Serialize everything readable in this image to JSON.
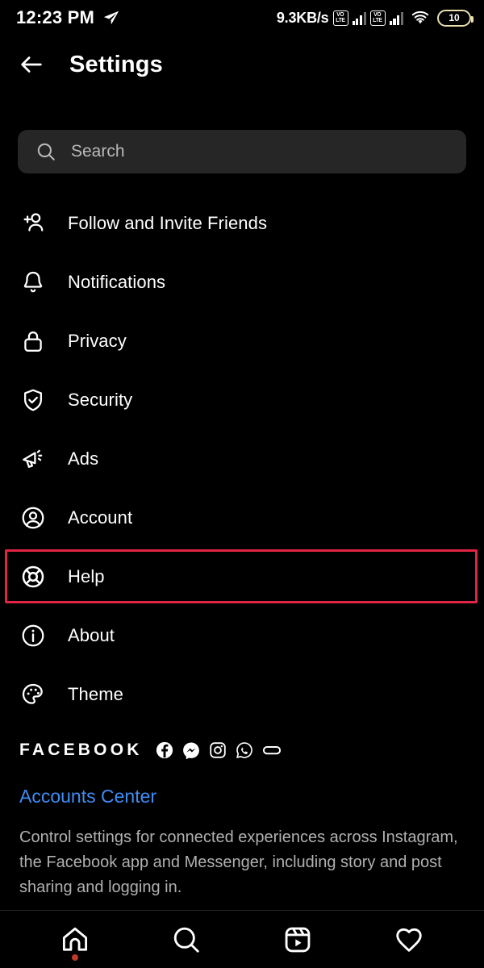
{
  "statusbar": {
    "time": "12:23 PM",
    "location_icon": "send-icon",
    "network_speed": "9.3KB/s",
    "sim1_label_top": "VO",
    "sim1_label_bottom": "LTE",
    "sim2_label_top": "VO",
    "sim2_label_bottom": "LTE",
    "wifi_icon": "wifi-icon",
    "battery_level": "10"
  },
  "topbar": {
    "back_icon": "arrow-left-icon",
    "title": "Settings"
  },
  "search": {
    "icon": "search-icon",
    "placeholder": "Search",
    "value": ""
  },
  "menu": {
    "items": [
      {
        "icon": "person-add-icon",
        "label": "Follow and Invite Friends",
        "highlighted": false
      },
      {
        "icon": "bell-icon",
        "label": "Notifications",
        "highlighted": false
      },
      {
        "icon": "lock-icon",
        "label": "Privacy",
        "highlighted": false
      },
      {
        "icon": "shield-check-icon",
        "label": "Security",
        "highlighted": false
      },
      {
        "icon": "megaphone-icon",
        "label": "Ads",
        "highlighted": false
      },
      {
        "icon": "account-circle-icon",
        "label": "Account",
        "highlighted": false
      },
      {
        "icon": "lifebuoy-icon",
        "label": "Help",
        "highlighted": true
      },
      {
        "icon": "info-circle-icon",
        "label": "About",
        "highlighted": false
      },
      {
        "icon": "palette-icon",
        "label": "Theme",
        "highlighted": false
      }
    ]
  },
  "facebook_section": {
    "brand": "FACEBOOK",
    "brand_icons": [
      "facebook-icon",
      "messenger-icon",
      "instagram-icon",
      "whatsapp-icon",
      "portal-icon"
    ],
    "link_label": "Accounts Center",
    "description": "Control settings for connected experiences across Instagram, the Facebook app and Messenger, including story and post sharing and logging in."
  },
  "bottomnav": {
    "items": [
      {
        "icon": "home-icon",
        "has_dot": true
      },
      {
        "icon": "search-icon",
        "has_dot": false
      },
      {
        "icon": "reels-icon",
        "has_dot": false
      },
      {
        "icon": "heart-icon",
        "has_dot": false
      }
    ]
  },
  "colors": {
    "background": "#000000",
    "search_field": "#262626",
    "highlight_red": "#e02444",
    "link_blue": "#3f8cf3",
    "muted_text": "#b0b0b0",
    "nav_dot_red": "#c0392b"
  }
}
